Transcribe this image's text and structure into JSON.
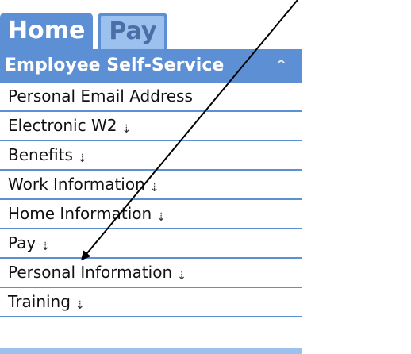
{
  "tabs": [
    {
      "label": "Home"
    },
    {
      "label": "Pay"
    }
  ],
  "section": {
    "title": "Employee Self-Service",
    "collapse_icon": "^"
  },
  "menu": [
    {
      "label": "Personal Email Address",
      "has_submenu": false
    },
    {
      "label": "Electronic W2",
      "has_submenu": true
    },
    {
      "label": "Benefits",
      "has_submenu": true
    },
    {
      "label": "Work Information",
      "has_submenu": true
    },
    {
      "label": "Home Information",
      "has_submenu": true
    },
    {
      "label": "Pay",
      "has_submenu": true
    },
    {
      "label": "Personal Information",
      "has_submenu": true
    },
    {
      "label": "Training",
      "has_submenu": true
    }
  ],
  "expand_icon_glyph": "⇣",
  "colors": {
    "header_blue": "#5c8fd3",
    "tab_light_blue": "#9dc1ee",
    "annotation_arrow": "#000000"
  }
}
